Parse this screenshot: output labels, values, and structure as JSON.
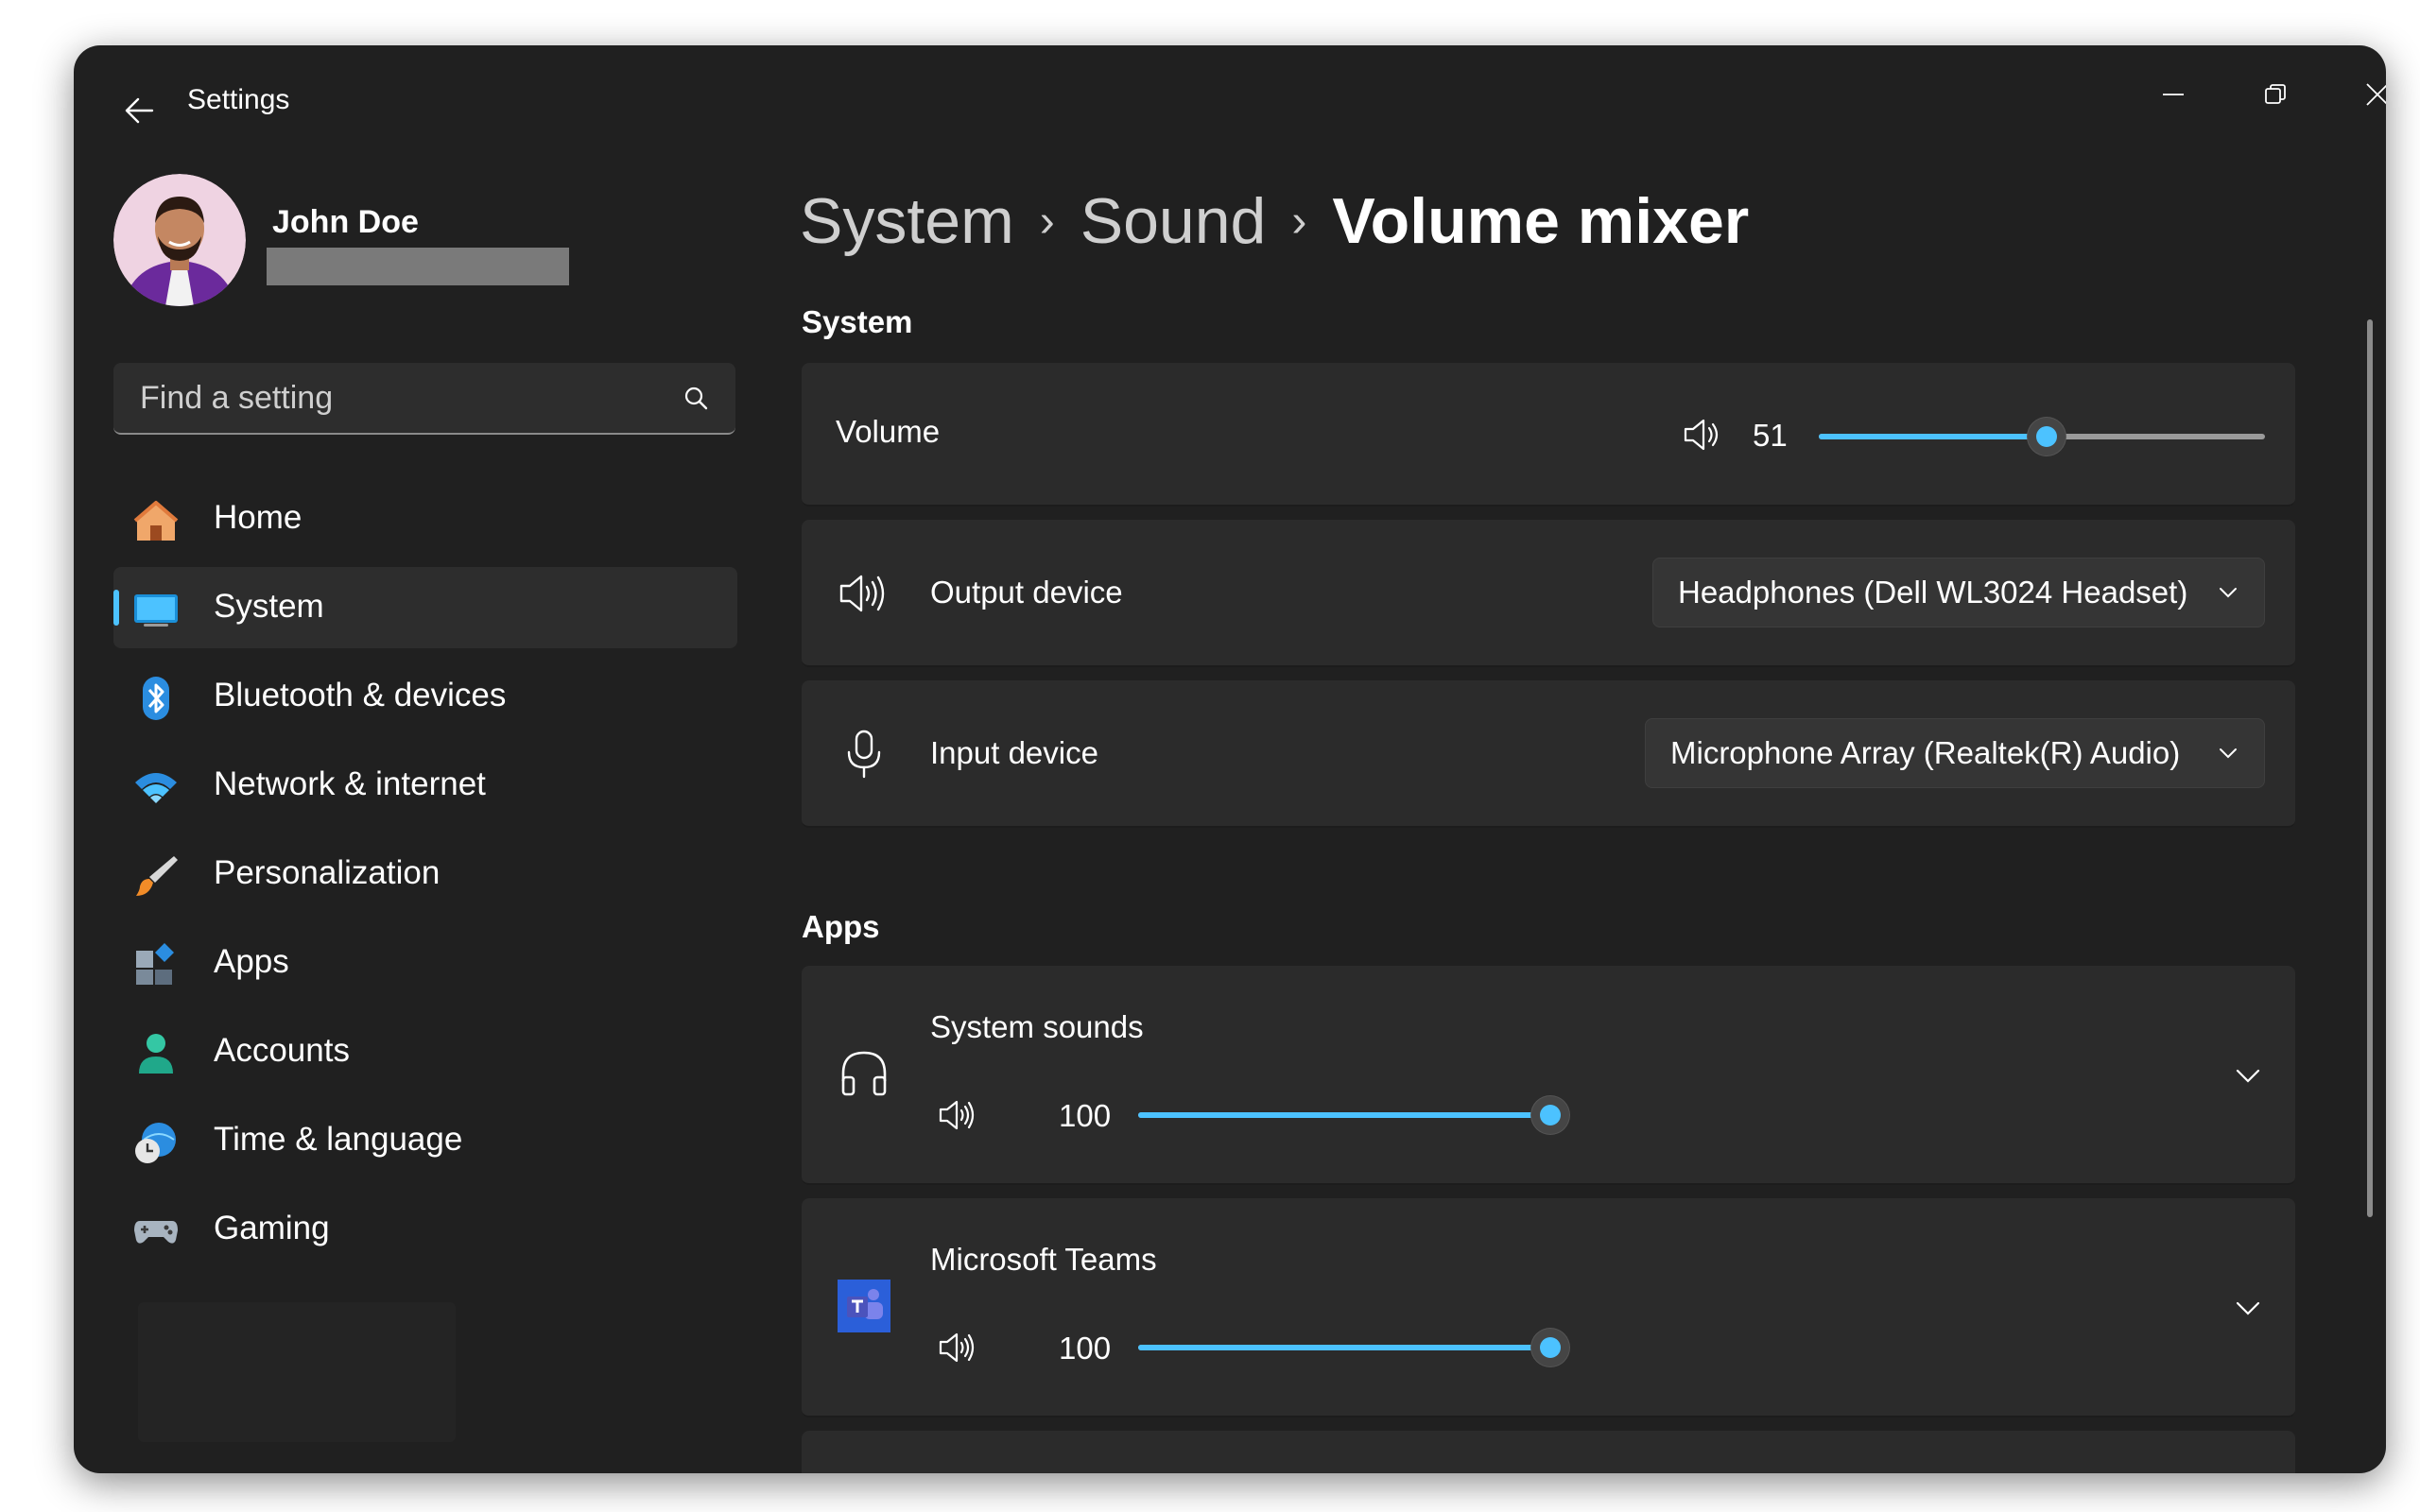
{
  "window": {
    "title": "Settings"
  },
  "profile": {
    "name": "John Doe"
  },
  "search": {
    "placeholder": "Find a setting"
  },
  "nav": {
    "items": [
      {
        "label": "Home",
        "icon": "home-icon"
      },
      {
        "label": "System",
        "icon": "monitor-icon",
        "selected": true
      },
      {
        "label": "Bluetooth & devices",
        "icon": "bluetooth-icon"
      },
      {
        "label": "Network & internet",
        "icon": "wifi-icon"
      },
      {
        "label": "Personalization",
        "icon": "brush-icon"
      },
      {
        "label": "Apps",
        "icon": "apps-icon"
      },
      {
        "label": "Accounts",
        "icon": "person-icon"
      },
      {
        "label": "Time & language",
        "icon": "globe-clock-icon"
      },
      {
        "label": "Gaming",
        "icon": "gamepad-icon"
      }
    ]
  },
  "breadcrumb": {
    "items": [
      "System",
      "Sound",
      "Volume mixer"
    ],
    "separator": "›"
  },
  "system_section": {
    "title": "System",
    "volume": {
      "label": "Volume",
      "value": "51",
      "level": 51
    },
    "output": {
      "label": "Output device",
      "selected": "Headphones (Dell WL3024 Headset)"
    },
    "input": {
      "label": "Input device",
      "selected": "Microphone Array (Realtek(R) Audio)"
    }
  },
  "apps_section": {
    "title": "Apps",
    "apps": [
      {
        "name": "System sounds",
        "icon": "headphones-icon",
        "volume": "100",
        "level": 100
      },
      {
        "name": "Microsoft Teams",
        "icon": "teams-icon",
        "volume": "100",
        "level": 100
      }
    ]
  },
  "colors": {
    "accent": "#4cc2ff",
    "background": "#202020",
    "card": "#2b2b2b"
  }
}
